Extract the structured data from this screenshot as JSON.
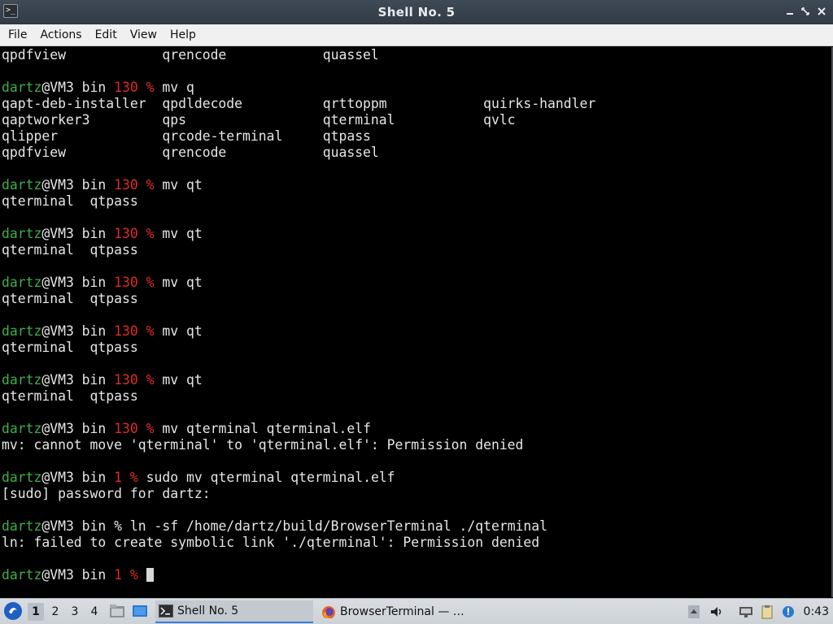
{
  "window": {
    "title": "Shell No. 5",
    "app_icon_glyph": ">_"
  },
  "menu": [
    "File",
    "Actions",
    "Edit",
    "View",
    "Help"
  ],
  "terminal": {
    "colors": {
      "user": "#3fae49",
      "exit_code": "#e02a2a",
      "text": "#e6e6e6"
    },
    "lines": [
      {
        "type": "plain",
        "text": "qpdfview            qrencode            quassel"
      },
      {
        "type": "plain",
        "text": ""
      },
      {
        "type": "prompt",
        "user": "dartz",
        "host": "@VM3 bin ",
        "code": "130 %",
        "cmd": " mv q"
      },
      {
        "type": "plain",
        "text": "qapt-deb-installer  qpdldecode          qrttoppm            quirks-handler"
      },
      {
        "type": "plain",
        "text": "qaptworker3         qps                 qterminal           qvlc"
      },
      {
        "type": "plain",
        "text": "qlipper             qrcode-terminal     qtpass"
      },
      {
        "type": "plain",
        "text": "qpdfview            qrencode            quassel"
      },
      {
        "type": "plain",
        "text": ""
      },
      {
        "type": "prompt",
        "user": "dartz",
        "host": "@VM3 bin ",
        "code": "130 %",
        "cmd": " mv qt"
      },
      {
        "type": "plain",
        "text": "qterminal  qtpass"
      },
      {
        "type": "plain",
        "text": ""
      },
      {
        "type": "prompt",
        "user": "dartz",
        "host": "@VM3 bin ",
        "code": "130 %",
        "cmd": " mv qt"
      },
      {
        "type": "plain",
        "text": "qterminal  qtpass"
      },
      {
        "type": "plain",
        "text": ""
      },
      {
        "type": "prompt",
        "user": "dartz",
        "host": "@VM3 bin ",
        "code": "130 %",
        "cmd": " mv qt"
      },
      {
        "type": "plain",
        "text": "qterminal  qtpass"
      },
      {
        "type": "plain",
        "text": ""
      },
      {
        "type": "prompt",
        "user": "dartz",
        "host": "@VM3 bin ",
        "code": "130 %",
        "cmd": " mv qt"
      },
      {
        "type": "plain",
        "text": "qterminal  qtpass"
      },
      {
        "type": "plain",
        "text": ""
      },
      {
        "type": "prompt",
        "user": "dartz",
        "host": "@VM3 bin ",
        "code": "130 %",
        "cmd": " mv qt"
      },
      {
        "type": "plain",
        "text": "qterminal  qtpass"
      },
      {
        "type": "plain",
        "text": ""
      },
      {
        "type": "prompt",
        "user": "dartz",
        "host": "@VM3 bin ",
        "code": "130 %",
        "cmd": " mv qterminal qterminal.elf"
      },
      {
        "type": "plain",
        "text": "mv: cannot move 'qterminal' to 'qterminal.elf': Permission denied"
      },
      {
        "type": "plain",
        "text": ""
      },
      {
        "type": "prompt",
        "user": "dartz",
        "host": "@VM3 bin ",
        "code": "1 %",
        "cmd": " sudo mv qterminal qterminal.elf"
      },
      {
        "type": "plain",
        "text": "[sudo] password for dartz:"
      },
      {
        "type": "plain",
        "text": ""
      },
      {
        "type": "prompt",
        "user": "dartz",
        "host": "@VM3 bin % ln -sf /home/dartz/build/BrowserTerminal ./qterminal",
        "code": "",
        "cmd": ""
      },
      {
        "type": "plain",
        "text": "ln: failed to create symbolic link './qterminal': Permission denied"
      },
      {
        "type": "plain",
        "text": ""
      },
      {
        "type": "prompt",
        "user": "dartz",
        "host": "@VM3 bin ",
        "code": "1 %",
        "cmd": " ",
        "cursor": true
      }
    ]
  },
  "taskbar": {
    "workspaces": [
      "1",
      "2",
      "3",
      "4"
    ],
    "active_workspace": "1",
    "tasks": [
      {
        "label": "Shell No. 5",
        "icon": "terminal-icon",
        "active": true
      },
      {
        "label": "BrowserTerminal — …",
        "icon": "firefox-icon",
        "active": false
      }
    ],
    "clock": "0:43"
  }
}
